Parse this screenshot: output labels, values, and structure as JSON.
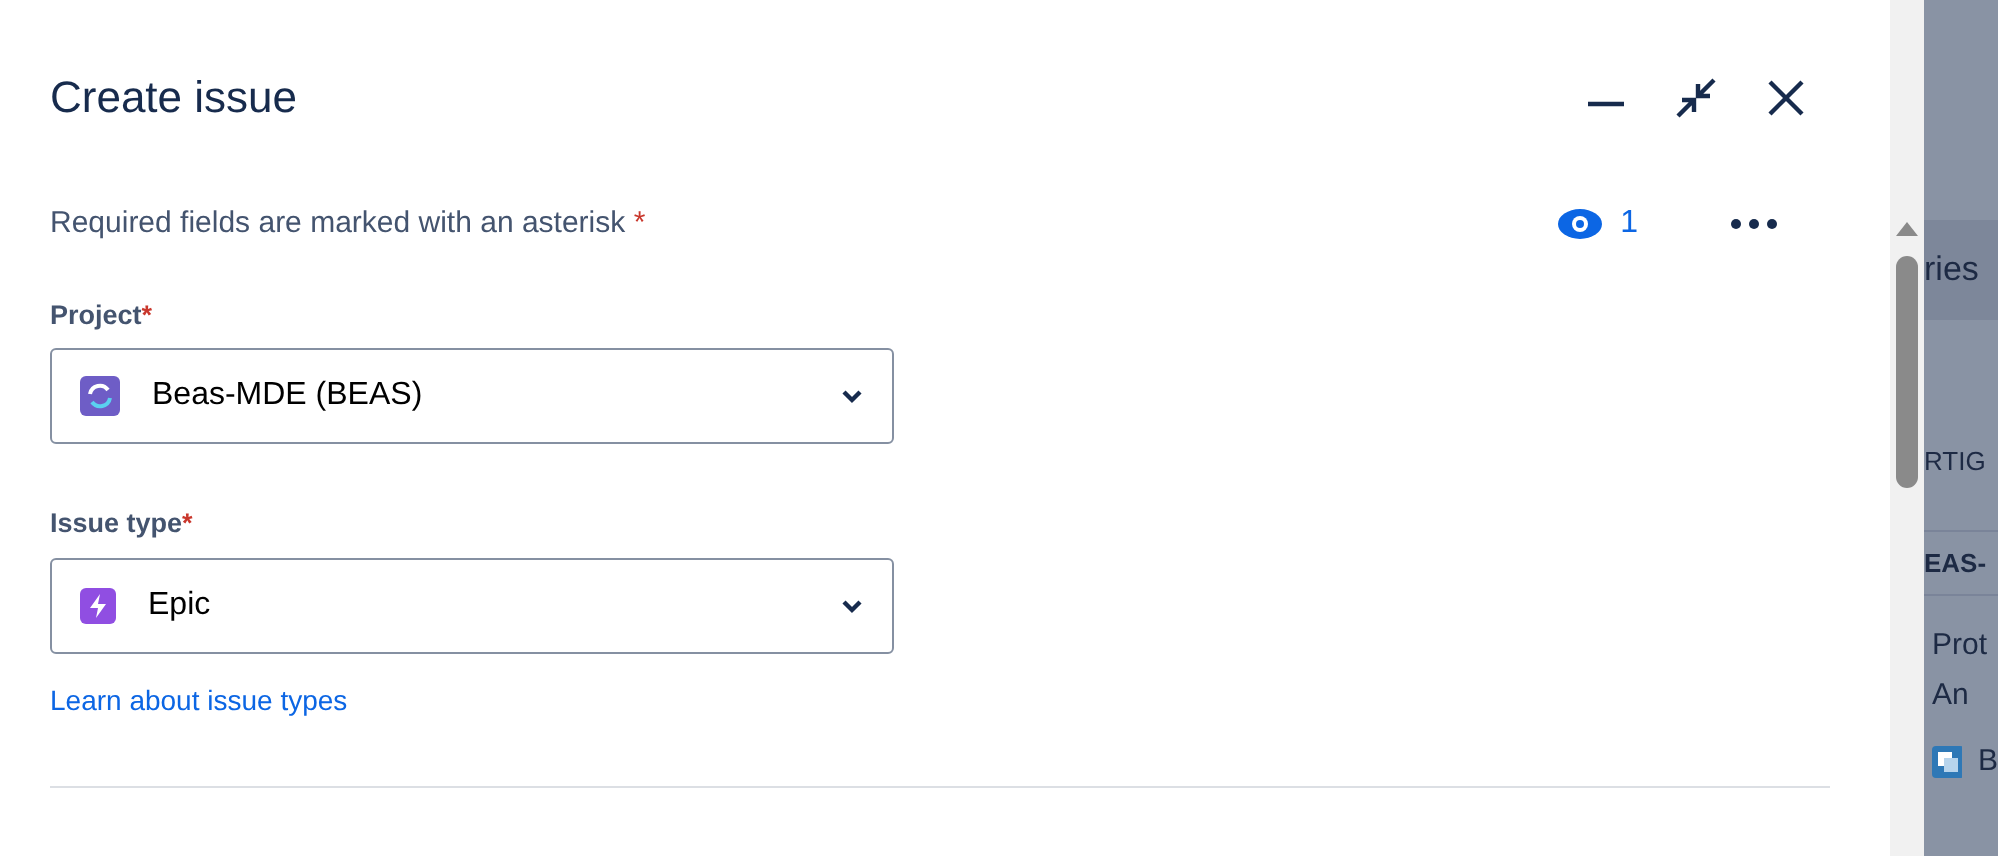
{
  "dialog": {
    "title": "Create issue",
    "watchers": {
      "count": "1"
    },
    "required_note": {
      "text": "Required fields are marked with an asterisk",
      "asterisk": "*"
    },
    "fields": [
      {
        "label": "Project",
        "asterisk": "*",
        "value": "Beas-MDE (BEAS)"
      },
      {
        "label": "Issue type",
        "asterisk": "*",
        "value": "Epic"
      }
    ],
    "link": "Learn about issue types"
  },
  "background": {
    "header": "ries",
    "rows": [
      {
        "text": "RTIG"
      },
      {
        "text": "EAS-"
      }
    ],
    "card": {
      "lines": [
        "Prot",
        "An"
      ],
      "footer": "B"
    }
  }
}
